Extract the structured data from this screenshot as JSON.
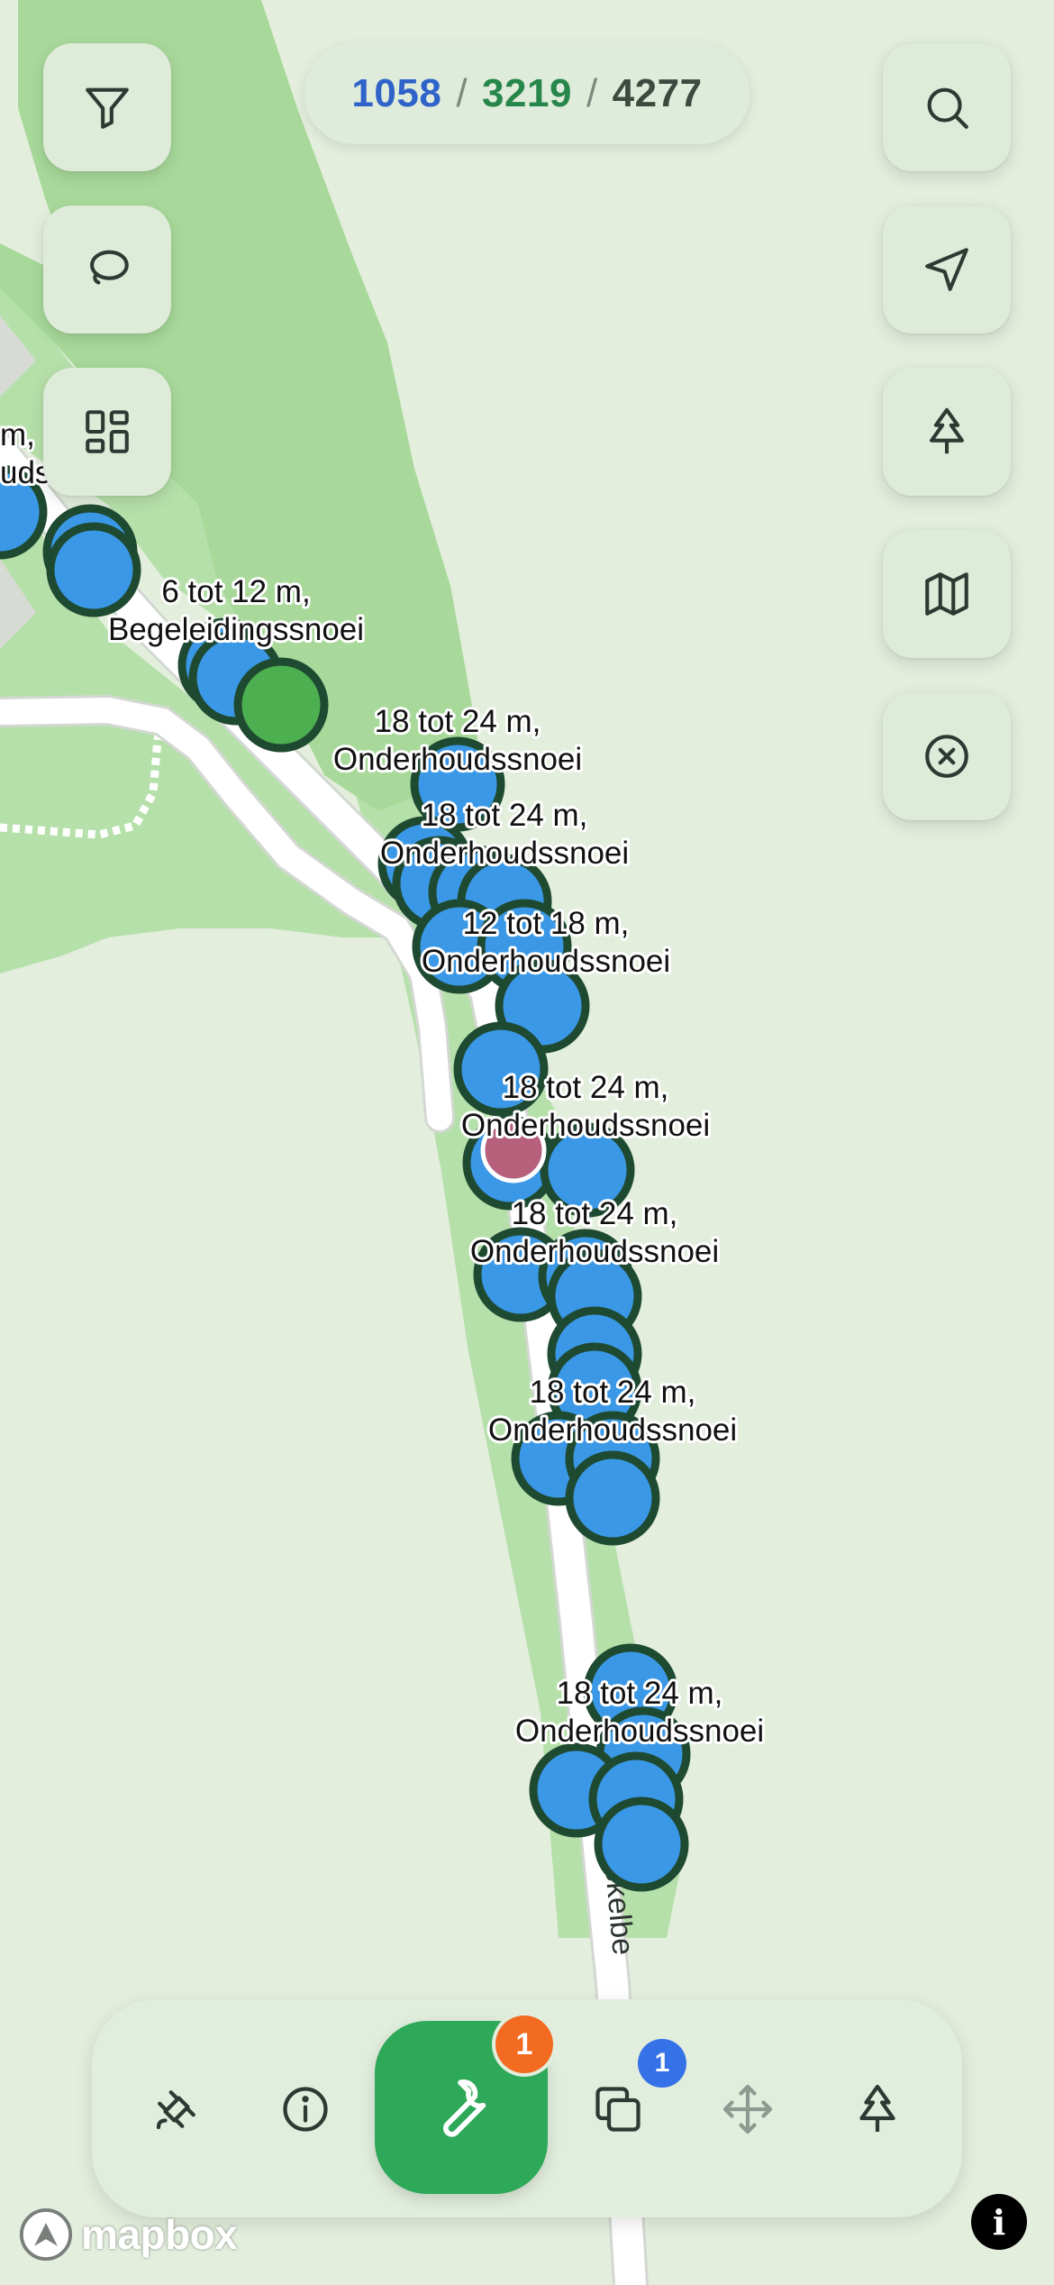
{
  "counts": {
    "blue": "1058",
    "sep1": "/",
    "green": "3219",
    "sep2": "/",
    "total": "4277"
  },
  "left_buttons": [
    {
      "name": "filter-button",
      "icon": "filter-icon"
    },
    {
      "name": "lasso-button",
      "icon": "lasso-icon"
    },
    {
      "name": "layout-button",
      "icon": "dashboard-icon"
    }
  ],
  "right_buttons": [
    {
      "name": "search-button",
      "icon": "search-icon"
    },
    {
      "name": "locate-button",
      "icon": "navigation-arrow-icon"
    },
    {
      "name": "tree-layer-button",
      "icon": "tree-icon"
    },
    {
      "name": "map-style-button",
      "icon": "map-icon"
    },
    {
      "name": "clear-button",
      "icon": "close-circle-icon"
    }
  ],
  "map_labels": [
    {
      "line1": "6 tot 12 m,",
      "line2": "Begeleidingssnoei"
    },
    {
      "line1": "18 tot 24 m,",
      "line2": "Onderhoudssnoei"
    },
    {
      "line1": "18 tot 24 m,",
      "line2": "Onderhoudssnoei"
    },
    {
      "line1": "12 tot 18 m,",
      "line2": "Onderhoudssnoei"
    },
    {
      "line1": "18 tot 24 m,",
      "line2": "Onderhoudssnoei"
    },
    {
      "line1": "18 tot 24 m,",
      "line2": "Onderhoudssnoei"
    },
    {
      "line1": "18 tot 24 m,",
      "line2": "Onderhoudssnoei"
    },
    {
      "line1": "18 tot 24 m,",
      "line2": "Onderhoudssnoei"
    }
  ],
  "clipped_label": {
    "line1": "m,",
    "line2": "udss"
  },
  "street_name": "ekelbe",
  "bottom_bar": {
    "items": [
      {
        "name": "satellite-button",
        "icon": "satellite-icon"
      },
      {
        "name": "info-button",
        "icon": "info-icon"
      },
      {
        "name": "maintenance-button",
        "icon": "wrench-icon",
        "badge": "1",
        "badge_color": "#f26b21"
      },
      {
        "name": "selection-button",
        "icon": "copy-icon",
        "badge": "1",
        "badge_color": "#3572e8"
      },
      {
        "name": "move-button",
        "icon": "move-icon"
      },
      {
        "name": "add-tree-button",
        "icon": "tree-icon"
      }
    ]
  },
  "attribution": {
    "logo_text": "mapbox",
    "info_symbol": "i"
  },
  "colors": {
    "tree_blue": "#3a98e6",
    "tree_green": "#4caf50",
    "tree_outline": "#1f4a32",
    "selected": "#b6607c",
    "accent_green": "#2ea95a"
  }
}
